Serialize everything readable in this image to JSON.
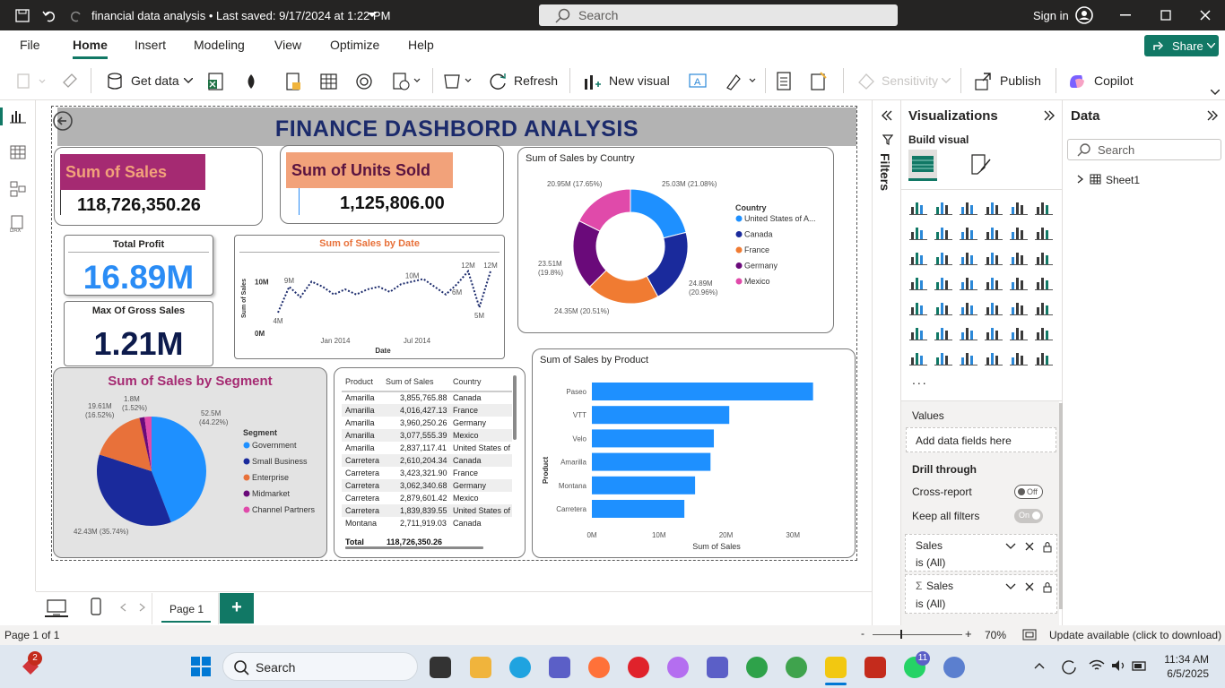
{
  "titlebar": {
    "document": "financial data analysis",
    "saved": "• Last saved: 9/17/2024 at 1:22 PM",
    "search_placeholder": "Search",
    "signin": "Sign in"
  },
  "menu": {
    "items": [
      "File",
      "Home",
      "Insert",
      "Modeling",
      "View",
      "Optimize",
      "Help"
    ],
    "share": "Share"
  },
  "ribbon": {
    "get_data": "Get data",
    "refresh": "Refresh",
    "new_visual": "New visual",
    "sensitivity": "Sensitivity",
    "publish": "Publish",
    "copilot": "Copilot"
  },
  "report": {
    "title": "FINANCE DASHBORD ANALYSIS",
    "kpi_sales": {
      "label": "Sum of Sales",
      "value": "118,726,350.26",
      "color": "#a52a72"
    },
    "kpi_units": {
      "label": "Sum of Units Sold",
      "value": "1,125,806.00",
      "color": "#f2a27a"
    },
    "kpi_profit": {
      "label": "Total Profit",
      "value": "16.89M",
      "color": "#2a8cf5"
    },
    "kpi_gross": {
      "label": "Max Of Gross Sales",
      "value": "1.21M",
      "color": "#0d1b4c"
    }
  },
  "chart_data": [
    {
      "type": "line",
      "title": "Sum of Sales by Date",
      "xlabel": "Date",
      "ylabel": "Sum of Sales",
      "x_ticks": [
        "Jan 2014",
        "Jul 2014"
      ],
      "y_ticks": [
        "0M",
        "10M"
      ],
      "ylim": [
        0,
        13
      ],
      "values": [
        4,
        9,
        7,
        10,
        9,
        7.5,
        8.5,
        7.5,
        8.5,
        9,
        8,
        9.5,
        10,
        10.5,
        9,
        7.5,
        9.5,
        12,
        5,
        12
      ],
      "annotations": [
        "4M",
        "9M",
        "10M",
        "6M",
        "12M",
        "5M",
        "12M"
      ],
      "color": "#1b2a6b"
    },
    {
      "type": "pie",
      "title": "Sum of Sales by Country",
      "legend_title": "Country",
      "labels": [
        "United States of A...",
        "Canada",
        "France",
        "Germany",
        "Mexico"
      ],
      "values": [
        25.03,
        24.89,
        24.35,
        23.51,
        20.95
      ],
      "value_labels": [
        "25.03M (21.08%)",
        "24.89M (20.96%)",
        "24.35M (20.51%)",
        "23.51M (19.8%)",
        "20.95M (17.65%)"
      ],
      "colors": [
        "#1e90ff",
        "#1a2a9c",
        "#f07b32",
        "#6a0a7a",
        "#e04aaa"
      ],
      "donut": true
    },
    {
      "type": "pie",
      "title": "Sum of Sales by Segment",
      "legend_title": "Segment",
      "labels": [
        "Government",
        "Small Business",
        "Enterprise",
        "Midmarket",
        "Channel Partners"
      ],
      "values": [
        52.5,
        42.43,
        19.61,
        1.8,
        2.44
      ],
      "value_labels": [
        "52.5M (44.22%)",
        "42.43M (35.74%)",
        "19.61M (16.52%)",
        "1.8M (1.52%)",
        ""
      ],
      "colors": [
        "#1e90ff",
        "#1a2a9c",
        "#e8713a",
        "#6a0a7a",
        "#e04aaa"
      ]
    },
    {
      "type": "bar",
      "orientation": "horizontal",
      "title": "Sum of Sales by Product",
      "xlabel": "Sum of Sales",
      "ylabel": "Product",
      "categories": [
        "Paseo",
        "VTT",
        "Velo",
        "Amarilla",
        "Montana",
        "Carretera"
      ],
      "values": [
        33.0,
        20.5,
        18.2,
        17.7,
        15.4,
        13.8
      ],
      "x_ticks": [
        "0M",
        "10M",
        "20M",
        "30M"
      ],
      "xlim": [
        0,
        38
      ],
      "color": "#1e90ff"
    },
    {
      "type": "table",
      "columns": [
        "Product",
        "Sum of Sales",
        "Country"
      ],
      "rows": [
        [
          "Amarilla",
          "3,855,765.88",
          "Canada"
        ],
        [
          "Amarilla",
          "4,016,427.13",
          "France"
        ],
        [
          "Amarilla",
          "3,960,250.26",
          "Germany"
        ],
        [
          "Amarilla",
          "3,077,555.39",
          "Mexico"
        ],
        [
          "Amarilla",
          "2,837,117.41",
          "United States of"
        ],
        [
          "Carretera",
          "2,610,204.34",
          "Canada"
        ],
        [
          "Carretera",
          "3,423,321.90",
          "France"
        ],
        [
          "Carretera",
          "3,062,340.68",
          "Germany"
        ],
        [
          "Carretera",
          "2,879,601.42",
          "Mexico"
        ],
        [
          "Carretera",
          "1,839,839.55",
          "United States of"
        ],
        [
          "Montana",
          "2,711,919.03",
          "Canada"
        ]
      ],
      "total": [
        "Total",
        "118,726,350.26",
        ""
      ]
    }
  ],
  "panes": {
    "filters": "Filters",
    "visualizations": "Visualizations",
    "build_visual": "Build visual",
    "values": "Values",
    "add_fields": "Add data fields here",
    "drill_through": "Drill through",
    "cross_report": "Cross-report",
    "cross_report_state": "Off",
    "keep_filters": "Keep all filters",
    "keep_filters_state": "On",
    "filter_cards": [
      {
        "field": "Sales",
        "state": "is (All)"
      },
      {
        "field": "Sales",
        "state": "is (All)"
      }
    ],
    "data": "Data",
    "data_search": "Search",
    "table": "Sheet1",
    "more": "..."
  },
  "pages": {
    "tab": "Page 1",
    "add": "+"
  },
  "status": {
    "page": "Page 1 of 1",
    "zoom": "70%",
    "update": "Update available (click to download)"
  },
  "taskbar": {
    "search": "Search",
    "time": "11:34 AM",
    "date": "6/5/2025",
    "badge_start": "2",
    "badge_whatsapp": "11"
  }
}
